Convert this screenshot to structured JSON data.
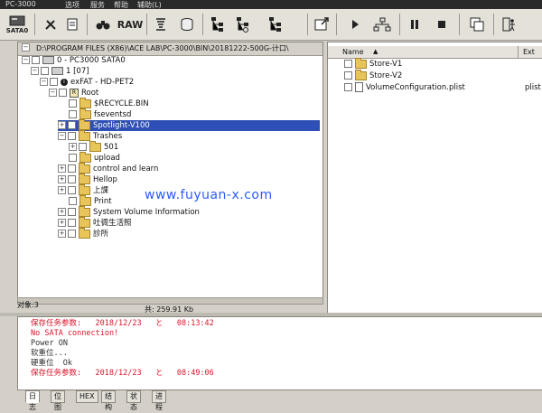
{
  "menubar": {
    "title": "PC-3000",
    "items": [
      "选项",
      "服务",
      "帮助",
      "辅助(L)"
    ]
  },
  "toolbar": {
    "sata_label": "SATA0",
    "raw_label": "RAW",
    "icons": [
      "sata-drive-icon",
      "tools-icon",
      "report-icon",
      "binoculars-icon",
      "raw-icon",
      "filter-icon",
      "database-icon",
      "tree-icon",
      "tree-export-icon",
      "tree-save-icon",
      "export-icon",
      "play-icon",
      "network-icon",
      "pause-icon",
      "stop-icon",
      "copy-icon",
      "exit-icon"
    ]
  },
  "left": {
    "path": "D:\\PROGRAM FILES (X86)\\ACE LAB\\PC-3000\\BIN\\20181222-500G-计口\\",
    "tree": [
      {
        "label": "0 - PC3000 SATA0",
        "level": 1,
        "icon": "drive"
      },
      {
        "label": "1 [07]",
        "level": 2,
        "icon": "drive"
      },
      {
        "label": "exFAT - HD-PET2",
        "level": 3,
        "icon": "info"
      },
      {
        "label": "Root",
        "level": 4,
        "icon": "root"
      },
      {
        "label": "$RECYCLE.BIN",
        "level": 5,
        "icon": "folder"
      },
      {
        "label": "fseventsd",
        "level": 5,
        "icon": "folder"
      },
      {
        "label": "Spotlight-V100",
        "level": 5,
        "icon": "folder",
        "selected": true
      },
      {
        "label": "Trashes",
        "level": 5,
        "icon": "folder"
      },
      {
        "label": "501",
        "level": 6,
        "icon": "folder"
      },
      {
        "label": "upload",
        "level": 5,
        "icon": "folder"
      },
      {
        "label": "control and learn",
        "level": 5,
        "icon": "folder"
      },
      {
        "label": "Hellop",
        "level": 5,
        "icon": "folder"
      },
      {
        "label": "上課",
        "level": 5,
        "icon": "folder"
      },
      {
        "label": "Print",
        "level": 5,
        "icon": "folder"
      },
      {
        "label": "System Volume Information",
        "level": 5,
        "icon": "folder"
      },
      {
        "label": "吐徟生活照",
        "level": 5,
        "icon": "folder"
      },
      {
        "label": "診所",
        "level": 5,
        "icon": "folder"
      }
    ],
    "watermark": "www.fuyuan-x.com",
    "status_objects": "对象:3",
    "status_total": "共: 259.91 Kb"
  },
  "right": {
    "col_name": "Name",
    "col_ext": "Ext",
    "items": [
      {
        "name": "Store-V1",
        "ext": "",
        "icon": "folder"
      },
      {
        "name": "Store-V2",
        "ext": "",
        "icon": "folder"
      },
      {
        "name": "VolumeConfiguration.plist",
        "ext": "plist",
        "icon": "file"
      }
    ]
  },
  "log": [
    {
      "text": "保存任务参数:   2018/12/23   と   08:13:42",
      "color": "red"
    },
    {
      "text": "No SATA connection!",
      "color": "red"
    },
    {
      "text": "Power ON",
      "color": "dark"
    },
    {
      "text": "软重位...",
      "color": "dark"
    },
    {
      "text": "硬重位  Ok",
      "color": "dark"
    },
    {
      "text": "保存任务参数:   2018/12/23   と   08:49:06",
      "color": "red"
    }
  ],
  "tabs": [
    "日志",
    "位图",
    "HEX",
    "结构",
    "状态",
    "进程"
  ],
  "colors": {
    "selection": "#2e4fb5",
    "log_red": "#d8142a",
    "watermark": "#2a5cff"
  }
}
